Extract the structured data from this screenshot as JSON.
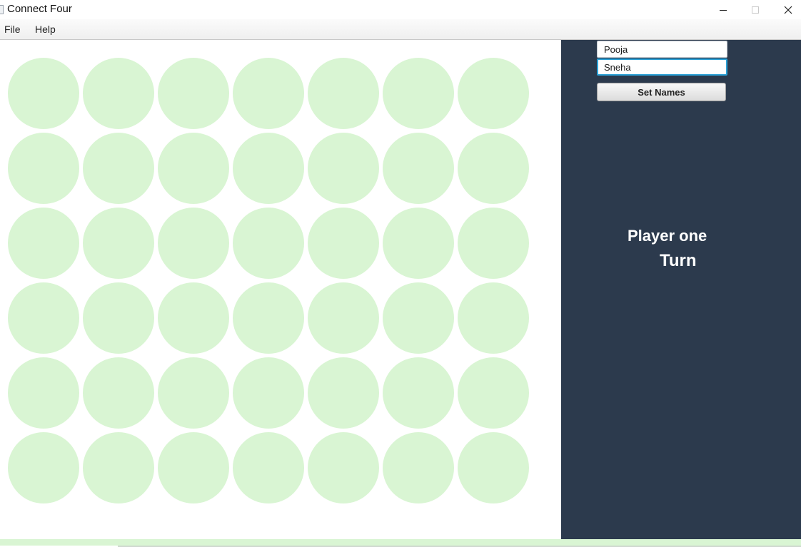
{
  "window": {
    "title": "Connect Four"
  },
  "menu": {
    "file_label": "File",
    "help_label": "Help"
  },
  "board": {
    "rows": 6,
    "columns": 7,
    "empty_cell_color": "#d9f5d3",
    "background_color": "#ffffff"
  },
  "panel": {
    "background_color": "#2c3a4d",
    "player_one_name": "Pooja",
    "player_two_name": "Sneha",
    "set_names_label": "Set Names",
    "turn_player": "Player one",
    "turn_label": "Turn"
  },
  "colors": {
    "focus_border": "#2aa0d6",
    "turn_text": "#ffffff"
  }
}
